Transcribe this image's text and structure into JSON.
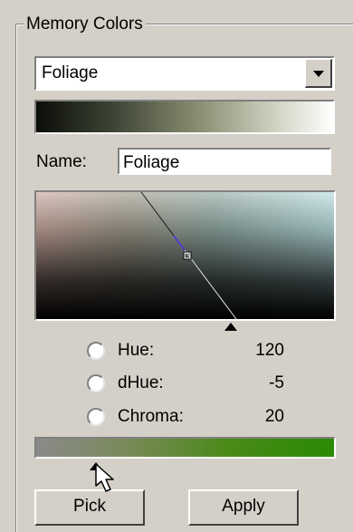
{
  "group": {
    "title": "Memory Colors"
  },
  "preset_dropdown": {
    "selected": "Foliage"
  },
  "name_field": {
    "label": "Name:",
    "value": "Foliage"
  },
  "options": [
    {
      "label": "Hue:",
      "value": "120"
    },
    {
      "label": "dHue:",
      "value": "-5"
    },
    {
      "label": "Chroma:",
      "value": "20"
    }
  ],
  "buttons": {
    "left_label": "Pick",
    "right_label": "Apply"
  },
  "colors": {
    "window_bg": "#d4d0c8",
    "hue_bar_end": "#2a8a05",
    "hue_bar_start": "#8a8a8a"
  }
}
